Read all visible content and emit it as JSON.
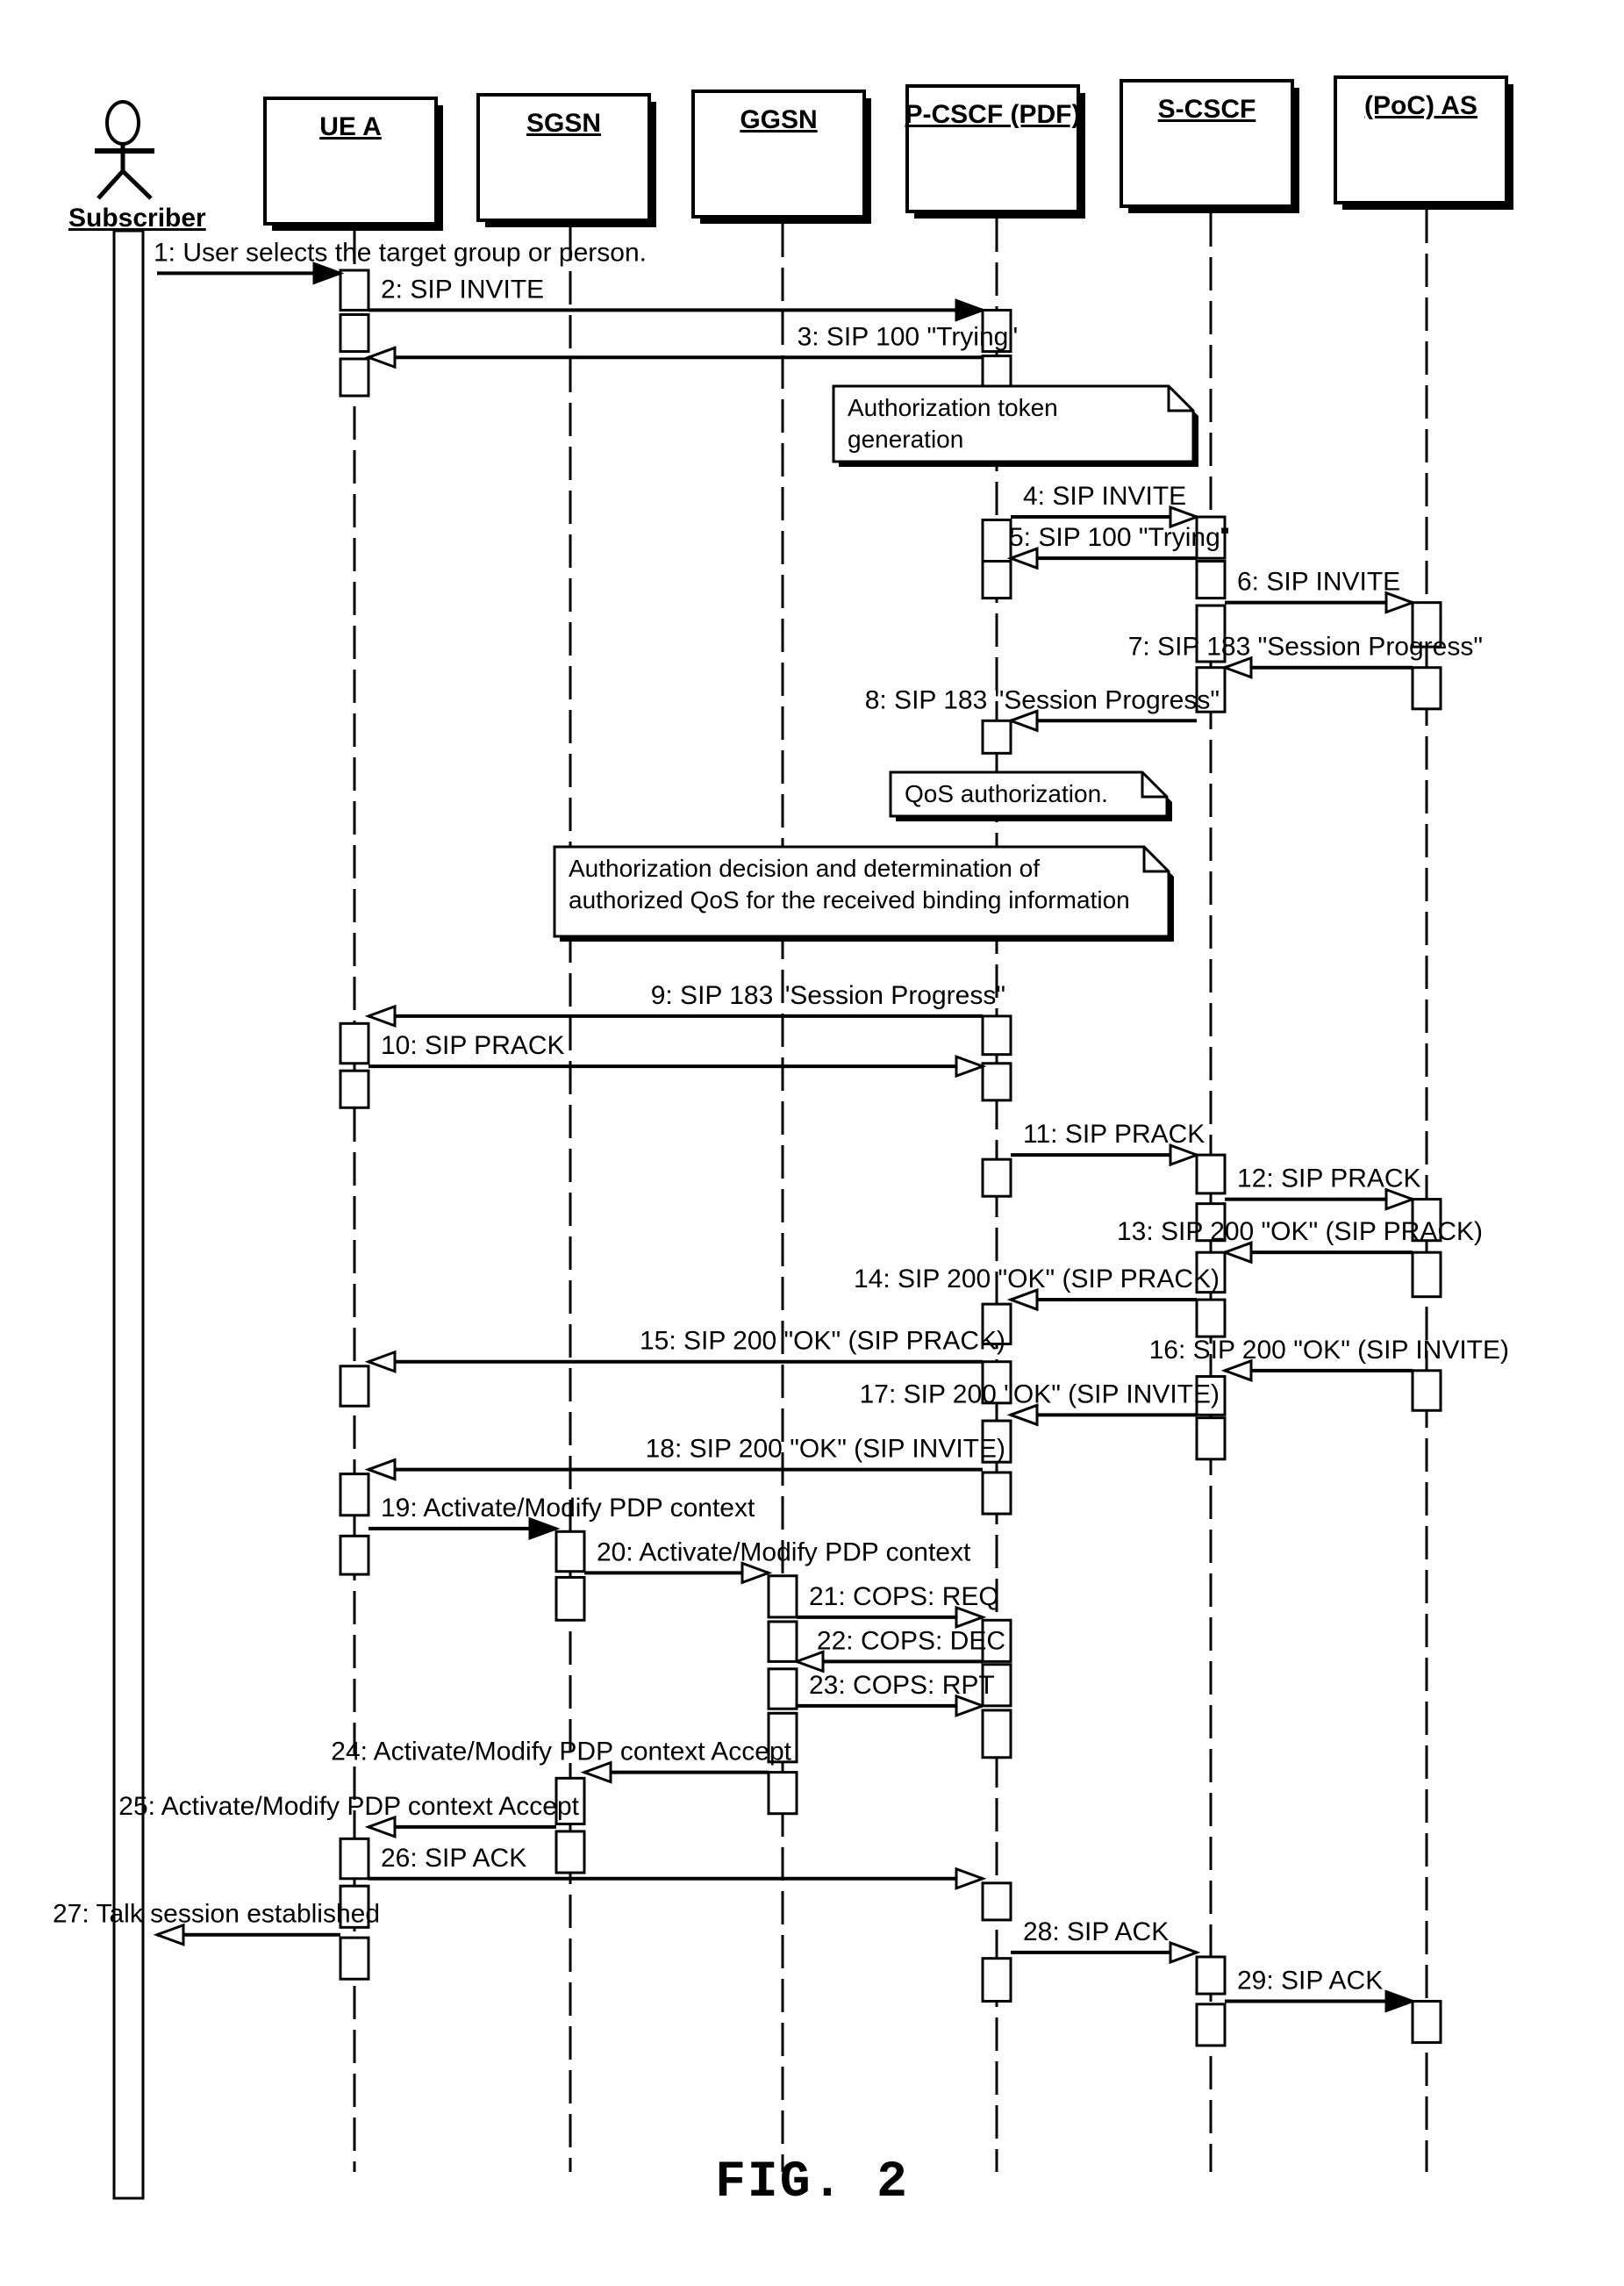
{
  "figure": {
    "caption": "FIG. 2",
    "type": "UML sequence diagram"
  },
  "actor": {
    "id": "subscriber",
    "label": "Subscriber"
  },
  "participants": [
    {
      "id": "ue_a",
      "label": "UE A"
    },
    {
      "id": "sgsn",
      "label": "SGSN"
    },
    {
      "id": "ggsn",
      "label": "GGSN"
    },
    {
      "id": "pcscf",
      "label": "P-CSCF (PDF)"
    },
    {
      "id": "scscf",
      "label": "S-CSCF"
    },
    {
      "id": "poc_as",
      "label": "(PoC) AS"
    }
  ],
  "messages": [
    {
      "n": 1,
      "label": "1: User selects the target group or person.",
      "from": "subscriber",
      "to": "ue_a"
    },
    {
      "n": 2,
      "label": "2: SIP INVITE",
      "from": "ue_a",
      "to": "pcscf"
    },
    {
      "n": 3,
      "label": "3: SIP 100 \"Trying\"",
      "from": "pcscf",
      "to": "ue_a"
    },
    {
      "n": 4,
      "label": "4: SIP INVITE",
      "from": "pcscf",
      "to": "scscf"
    },
    {
      "n": 5,
      "label": "5: SIP 100 \"Trying\"",
      "from": "scscf",
      "to": "pcscf"
    },
    {
      "n": 6,
      "label": "6: SIP INVITE",
      "from": "scscf",
      "to": "poc_as"
    },
    {
      "n": 7,
      "label": "7: SIP 183 \"Session Progress\"",
      "from": "poc_as",
      "to": "scscf"
    },
    {
      "n": 8,
      "label": "8: SIP 183 \"Session Progress\"",
      "from": "scscf",
      "to": "pcscf"
    },
    {
      "n": 9,
      "label": "9: SIP 183 \"Session Progress\"",
      "from": "pcscf",
      "to": "ue_a"
    },
    {
      "n": 10,
      "label": "10: SIP PRACK",
      "from": "ue_a",
      "to": "pcscf"
    },
    {
      "n": 11,
      "label": "11: SIP PRACK",
      "from": "pcscf",
      "to": "scscf"
    },
    {
      "n": 12,
      "label": "12: SIP PRACK",
      "from": "scscf",
      "to": "poc_as"
    },
    {
      "n": 13,
      "label": "13: SIP 200 \"OK\" (SIP PRACK)",
      "from": "poc_as",
      "to": "scscf"
    },
    {
      "n": 14,
      "label": "14: SIP 200 \"OK\" (SIP PRACK)",
      "from": "scscf",
      "to": "pcscf"
    },
    {
      "n": 15,
      "label": "15: SIP 200 \"OK\" (SIP PRACK)",
      "from": "pcscf",
      "to": "ue_a"
    },
    {
      "n": 16,
      "label": "16: SIP 200 \"OK\" (SIP INVITE)",
      "from": "poc_as",
      "to": "scscf"
    },
    {
      "n": 17,
      "label": "17: SIP 200 \"OK\" (SIP INVITE)",
      "from": "scscf",
      "to": "pcscf"
    },
    {
      "n": 18,
      "label": "18: SIP 200 \"OK\" (SIP INVITE)",
      "from": "pcscf",
      "to": "ue_a"
    },
    {
      "n": 19,
      "label": "19: Activate/Modify PDP context",
      "from": "ue_a",
      "to": "sgsn"
    },
    {
      "n": 20,
      "label": "20: Activate/Modify PDP context",
      "from": "sgsn",
      "to": "ggsn"
    },
    {
      "n": 21,
      "label": "21: COPS: REQ",
      "from": "ggsn",
      "to": "pcscf"
    },
    {
      "n": 22,
      "label": "22: COPS: DEC",
      "from": "pcscf",
      "to": "ggsn"
    },
    {
      "n": 23,
      "label": "23: COPS: RPT",
      "from": "ggsn",
      "to": "pcscf"
    },
    {
      "n": 24,
      "label": "24: Activate/Modify PDP context Accept",
      "from": "ggsn",
      "to": "sgsn"
    },
    {
      "n": 25,
      "label": "25: Activate/Modify PDP context Accept",
      "from": "sgsn",
      "to": "ue_a"
    },
    {
      "n": 26,
      "label": "26: SIP ACK",
      "from": "ue_a",
      "to": "pcscf"
    },
    {
      "n": 27,
      "label": "27: Talk session established",
      "from": "ue_a",
      "to": "subscriber"
    },
    {
      "n": 28,
      "label": "28: SIP ACK",
      "from": "pcscf",
      "to": "scscf"
    },
    {
      "n": 29,
      "label": "29: SIP ACK",
      "from": "scscf",
      "to": "poc_as"
    }
  ],
  "notes": [
    {
      "id": "token",
      "lines": [
        "Authorization token",
        "generation"
      ],
      "after_message": 3
    },
    {
      "id": "qos",
      "lines": [
        "QoS authorization."
      ],
      "after_message": 8
    },
    {
      "id": "decision",
      "lines": [
        "Authorization decision and determination of",
        "authorized QoS for the received binding information"
      ],
      "after_message": 8
    }
  ]
}
